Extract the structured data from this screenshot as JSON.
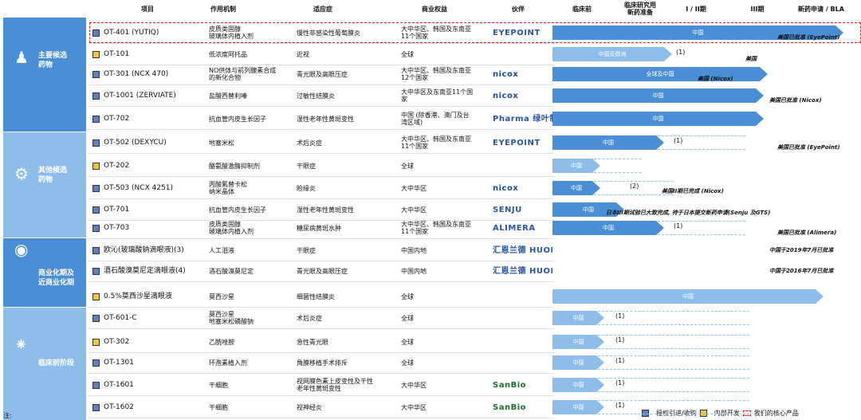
{
  "headers": {
    "item": "项目",
    "mechanism": "作用机制",
    "indication": "适应症",
    "rights": "商业权益",
    "partner": "伙伴",
    "preclinical": "临床前",
    "clinical_prep": "临床研究用\n新药准备",
    "phase12": "I / II期",
    "phase3": "III期",
    "nda": "新药申请 / BLA"
  },
  "groups": [
    {
      "label": "主要候选\n药物",
      "icon": "person-icon"
    },
    {
      "label": "其他候选\n药物",
      "icon": "gears-icon"
    },
    {
      "label": "商业化期及\n近商业化期",
      "icon": "money-bag-icon"
    },
    {
      "label": "临床前阶段",
      "icon": "molecule-icon"
    }
  ],
  "rows": [
    {
      "name": "OT-401 (YUTIQ)",
      "color": "blue",
      "mech": "皮质类固醇\n玻璃体内植入剂",
      "ind": "慢性非感染性葡萄膜炎",
      "rights": "大中华区、韩国及东南亚\n11个国家",
      "partner": "EYEPOINT",
      "bar_label": "中国",
      "note": "美国已批准 (EyePoint)",
      "paren": ""
    },
    {
      "name": "OT-101",
      "color": "yellow",
      "mech": "低浓度阿托品",
      "ind": "近视",
      "rights": "全球",
      "partner": "",
      "bar_label": "中国及欧洲",
      "note": "美国",
      "paren": "(1)"
    },
    {
      "name": "OT-301 (NCX 470)",
      "color": "blue",
      "mech": "NO供体与前列腺素合成\n的新化合物",
      "ind": "青光眼及高眼压症",
      "rights": "大中华区、韩国及东南亚\n12个国家",
      "partner": "nicox",
      "bar_label": "全球及中国",
      "note": "美国 (Nicox)",
      "paren": ""
    },
    {
      "name": "OT-1001 (ZERVIATE)",
      "color": "blue",
      "mech": "盐酸西替利嗪",
      "ind": "过敏性结膜炎",
      "rights": "大中华区及东南亚11个国\n家",
      "partner": "nicox",
      "bar_label": "中国",
      "note": "美国已批准 (Nicox)",
      "paren": ""
    },
    {
      "name": "OT-702",
      "color": "blue",
      "mech": "抗血管内皮生长因子",
      "ind": "湿性老年性黄斑变性",
      "rights": "中国 (除香港、澳门及台\n湾区域)",
      "partner": "Pharma 绿叶制药",
      "bar_label": "中国",
      "note": "",
      "paren": ""
    },
    {
      "name": "OT-502 (DEXYCU)",
      "color": "blue",
      "mech": "地塞米松",
      "ind": "术后炎症",
      "rights": "大中华区、韩国及东南亚\n11个国家",
      "partner": "EYEPOINT",
      "bar_label": "中国",
      "note": "美国已批准 (EyePoint)",
      "paren": "(1)"
    },
    {
      "name": "OT-202",
      "color": "yellow",
      "mech": "酪氨酸激酶抑制剂",
      "ind": "干眼症",
      "rights": "全球",
      "partner": "",
      "bar_label": "中国",
      "note": "",
      "paren": ""
    },
    {
      "name": "OT-503 (NCX 4251)",
      "color": "blue",
      "mech": "丙酸氟替卡松\n纳米晶体",
      "ind": "睑缘炎",
      "rights": "大中华区",
      "partner": "nicox",
      "bar_label": "中国",
      "note": "美国II期已完成 (Nicox)",
      "paren": "(2)"
    },
    {
      "name": "OT-701",
      "color": "blue",
      "mech": "抗血管内皮生长因子",
      "ind": "湿性老年性黄斑变性",
      "rights": "大中华区",
      "partner": "SENJU",
      "bar_label": "中国",
      "note": "日本III期试验已大致完成, 待于日本提交新药申请(Senju 及GTS)",
      "paren": ""
    },
    {
      "name": "OT-703",
      "color": "blue",
      "mech": "皮质类固醇\n玻璃体内植入剂",
      "ind": "糖尿病黄斑水肿",
      "rights": "大中华区、韩国及东南亚\n11个国家",
      "partner": "ALIMERA",
      "bar_label": "中国",
      "note": "美国已批准 (Alimera)",
      "paren": "(1)"
    },
    {
      "name": "欧沁(玻璃酸钠滴眼液)(3)",
      "color": "blue",
      "mech": "人工泪液",
      "ind": "干眼症",
      "rights": "中国内地",
      "partner": "汇恩兰德 HUONLAND",
      "bar_label": "",
      "note": "中国于2019年7月已批准",
      "paren": ""
    },
    {
      "name": "酒石酸溴莫尼定滴眼液(4)",
      "color": "blue",
      "mech": "酒石酸溴莫尼定",
      "ind": "青光眼及高眼压症",
      "rights": "中国内地",
      "partner": "汇恩兰德 HUONLAND",
      "bar_label": "",
      "note": "中国于2016年7月已批准",
      "paren": ""
    },
    {
      "name": "0.5%莫西沙星滴眼液",
      "color": "yellow",
      "mech": "莫西沙星",
      "ind": "细菌性结膜炎",
      "rights": "全球",
      "partner": "",
      "bar_label": "中国",
      "note": "",
      "paren": ""
    },
    {
      "name": "OT-601-C",
      "color": "blue",
      "mech": "莫西沙星\n地塞米松磷酸钠",
      "ind": "术后炎症",
      "rights": "全球",
      "partner": "",
      "bar_label": "中国",
      "note": "",
      "paren": "(1)"
    },
    {
      "name": "OT-302",
      "color": "yellow",
      "mech": "乙酰唑胺",
      "ind": "急性青光眼",
      "rights": "全球",
      "partner": "",
      "bar_label": "中国",
      "note": "",
      "paren": "(1)"
    },
    {
      "name": "OT-1301",
      "color": "blue",
      "mech": "环孢素植入剂",
      "ind": "角膜移植手术排斥",
      "rights": "全球",
      "partner": "",
      "bar_label": "中国",
      "note": "",
      "paren": "(1)"
    },
    {
      "name": "OT-1601",
      "color": "blue",
      "mech": "干细胞",
      "ind": "视网膜色素上皮变性及干性\n老年性黄斑变性",
      "rights": "大中华区",
      "partner": "SanBio",
      "bar_label": "中国",
      "note": "",
      "paren": "(1)"
    },
    {
      "name": "OT-1602",
      "color": "blue",
      "mech": "干细胞",
      "ind": "视神经炎",
      "rights": "大中华区",
      "partner": "SanBio",
      "bar_label": "中国",
      "note": "",
      "paren": "(1)"
    }
  ],
  "legend": {
    "licensed": "授权引进/收购",
    "inhouse": "内部开发",
    "core": "我们的核心产品"
  },
  "footnote": "注:"
}
